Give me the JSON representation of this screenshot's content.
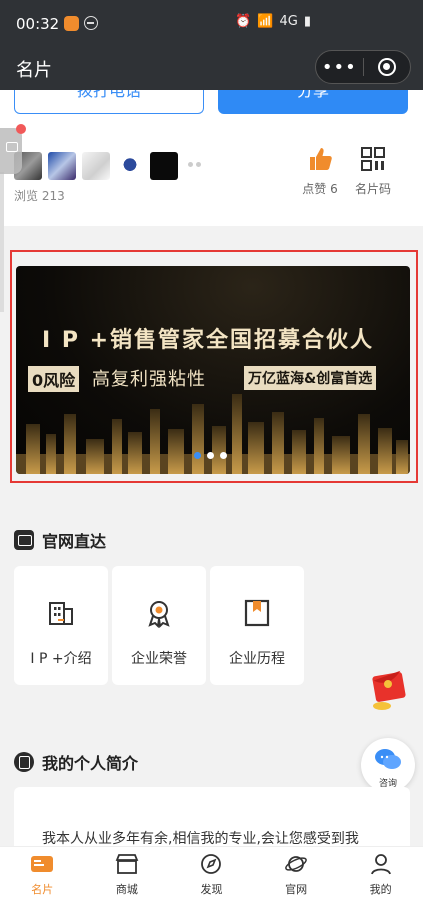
{
  "status_bar": {
    "time": "00:32",
    "network": "4G"
  },
  "nav": {
    "title": "名片",
    "more_label": "•••"
  },
  "card": {
    "call_button": "拨打电话",
    "share_button": "分享",
    "views_label": "浏览 213",
    "like_label": "点赞 6",
    "qrcode_label": "名片码"
  },
  "banner": {
    "title": "I P +销售管家全国招募合伙人",
    "tag_left": "0风险",
    "middle_text": "高复利强粘性",
    "tag_right": "万亿蓝海&创富首选",
    "slide_count": 3,
    "active_slide": 1
  },
  "official_section": {
    "title": "官网直达",
    "tiles": [
      {
        "label": "I P +介绍",
        "icon": "building-icon"
      },
      {
        "label": "企业荣誉",
        "icon": "award-icon"
      },
      {
        "label": "企业历程",
        "icon": "bookmark-book-icon"
      }
    ]
  },
  "profile_section": {
    "title": "我的个人简介",
    "text": "我本人从业多年有余,相信我的专业,会让您感受到我"
  },
  "consult": {
    "label": "咨询"
  },
  "tabbar": {
    "items": [
      {
        "label": "名片",
        "icon": "card-icon",
        "active": true
      },
      {
        "label": "商城",
        "icon": "shop-icon",
        "active": false
      },
      {
        "label": "发现",
        "icon": "compass-icon",
        "active": false
      },
      {
        "label": "官网",
        "icon": "planet-icon",
        "active": false
      },
      {
        "label": "我的",
        "icon": "user-icon",
        "active": false
      }
    ]
  },
  "colors": {
    "accent": "#f08c2d",
    "primary_blue": "#2f8af5",
    "highlight_border": "#e53935",
    "like_orange": "#f08c2d"
  }
}
